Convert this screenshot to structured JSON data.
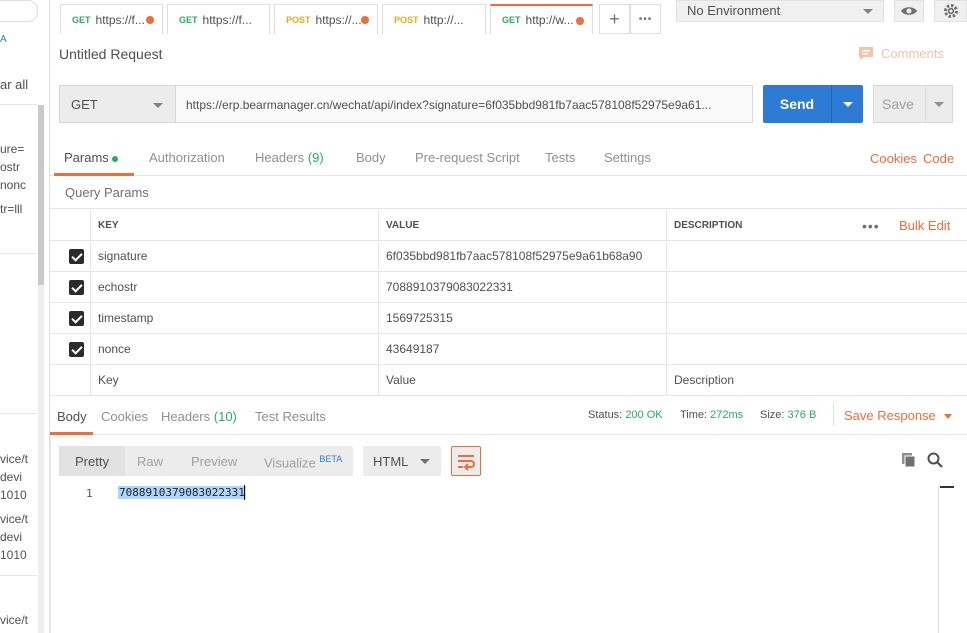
{
  "sidebar": {
    "partial_link": "A",
    "clear_all": "ar all",
    "history_fragments": [
      "ure=",
      "ostr",
      "nonc",
      "tr=lll",
      "vice/t",
      "devi",
      "1010",
      "vice/t",
      "devi",
      "1010",
      "vice/t"
    ]
  },
  "tabs": [
    {
      "method": "GET",
      "url": "https://f...",
      "unsaved": true
    },
    {
      "method": "GET",
      "url": "https://f...",
      "unsaved": false
    },
    {
      "method": "POST",
      "url": "https://...",
      "unsaved": true
    },
    {
      "method": "POST",
      "url": "http://...",
      "unsaved": false
    },
    {
      "method": "GET",
      "url": "http://w...",
      "unsaved": true,
      "active": true
    }
  ],
  "tab_actions": {
    "new_tab": "+",
    "more": "•••"
  },
  "environment": {
    "selected": "No Environment"
  },
  "request": {
    "title": "Untitled Request",
    "comments_label": "Comments",
    "method": "GET",
    "url": "https://erp.bearmanager.cn/wechat/api/index?signature=6f035bbd981fb7aac578108f52975e9a61...",
    "send_label": "Send",
    "save_label": "Save"
  },
  "request_tabs": {
    "params": "Params",
    "authorization": "Authorization",
    "headers": "Headers",
    "headers_count": "(9)",
    "body": "Body",
    "prerequest": "Pre-request Script",
    "tests": "Tests",
    "settings": "Settings",
    "cookies": "Cookies",
    "code": "Code"
  },
  "query_params": {
    "title": "Query Params",
    "headers": {
      "key": "KEY",
      "value": "VALUE",
      "description": "DESCRIPTION"
    },
    "bulk_edit": "Bulk Edit",
    "rows": [
      {
        "key": "signature",
        "value": "6f035bbd981fb7aac578108f52975e9a61b68a90",
        "description": ""
      },
      {
        "key": "echostr",
        "value": "7088910379083022331",
        "description": ""
      },
      {
        "key": "timestamp",
        "value": "1569725315",
        "description": ""
      },
      {
        "key": "nonce",
        "value": "43649187",
        "description": ""
      }
    ],
    "placeholder": {
      "key": "Key",
      "value": "Value",
      "description": "Description"
    }
  },
  "response_tabs": {
    "body": "Body",
    "cookies": "Cookies",
    "headers": "Headers",
    "headers_count": "(10)",
    "test_results": "Test Results"
  },
  "response_status": {
    "status_label": "Status:",
    "status_value": "200 OK",
    "time_label": "Time:",
    "time_value": "272ms",
    "size_label": "Size:",
    "size_value": "376 B",
    "save_response": "Save Response"
  },
  "viewer": {
    "modes": [
      "Pretty",
      "Raw",
      "Preview",
      "Visualize"
    ],
    "beta_badge": "BETA",
    "format": "HTML"
  },
  "response_body": {
    "line_number": "1",
    "line_text": "7088910379083022331"
  },
  "colors": {
    "accent": "#f26b3a",
    "send_blue": "#2e7bd6",
    "success_green": "#27ae60",
    "post_orange": "#f0a61c"
  }
}
